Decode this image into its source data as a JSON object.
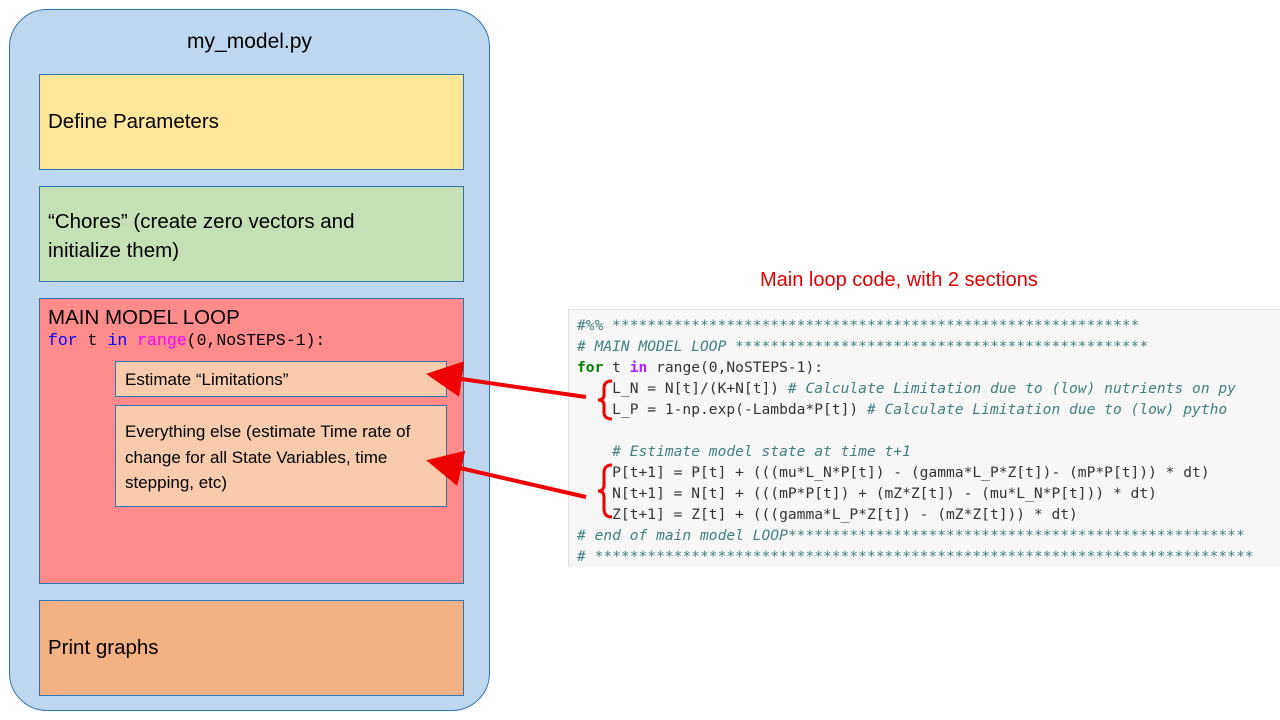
{
  "diagram": {
    "file_title": "my_model.py",
    "blocks": {
      "define_parameters": "Define Parameters",
      "chores_line1": "“Chores” (create zero vectors and",
      "chores_line2": "initialize them)",
      "main_loop_title": "MAIN MODEL LOOP",
      "loop_for": "for",
      "loop_t": " t ",
      "loop_in": "in",
      "loop_range": "range",
      "loop_args": "(0,NoSTEPS-1):",
      "estimate_limitations": "Estimate “Limitations”",
      "everything_else": "Everything else (estimate Time rate of change for all State Variables, time stepping, etc)",
      "print_graphs": "Print graphs"
    },
    "caption": "Main loop code, with 2 sections",
    "code": {
      "l1": "#%% ************************************************************",
      "l2": "# MAIN MODEL LOOP ***********************************************",
      "l3_for": "for",
      "l3_t": " t ",
      "l3_in": "in",
      "l3_rest": " range(0,NoSTEPS-1):",
      "l4_code": "    L_N = N[t]/(K+N[t]) ",
      "l4_comment": "# Calculate Limitation due to (low) nutrients on py",
      "l5_code": "    L_P = 1-np.exp(-Lambda*P[t]) ",
      "l5_comment": "# Calculate Limitation due to (low) pytho",
      "l6_comment": "    # Estimate model state at time t+1",
      "l7": "    P[t+1] = P[t] + (((mu*L_N*P[t]) - (gamma*L_P*Z[t])- (mP*P[t])) * dt)",
      "l8": "    N[t+1] = N[t] + (((mP*P[t]) + (mZ*Z[t]) - (mu*L_N*P[t])) * dt)",
      "l9": "    Z[t+1] = Z[t] + (((gamma*L_P*Z[t]) - (mZ*Z[t])) * dt)",
      "l10": "# end of main model LOOP****************************************************",
      "l11": "# ***************************************************************************"
    },
    "colors": {
      "arrow": "#ee0000",
      "caption": "#e00000",
      "outer": "#bdd7ee",
      "params": "#ffe699",
      "chores": "#c5e0b4",
      "loop": "#ff8b8b",
      "print": "#f4b183"
    }
  }
}
